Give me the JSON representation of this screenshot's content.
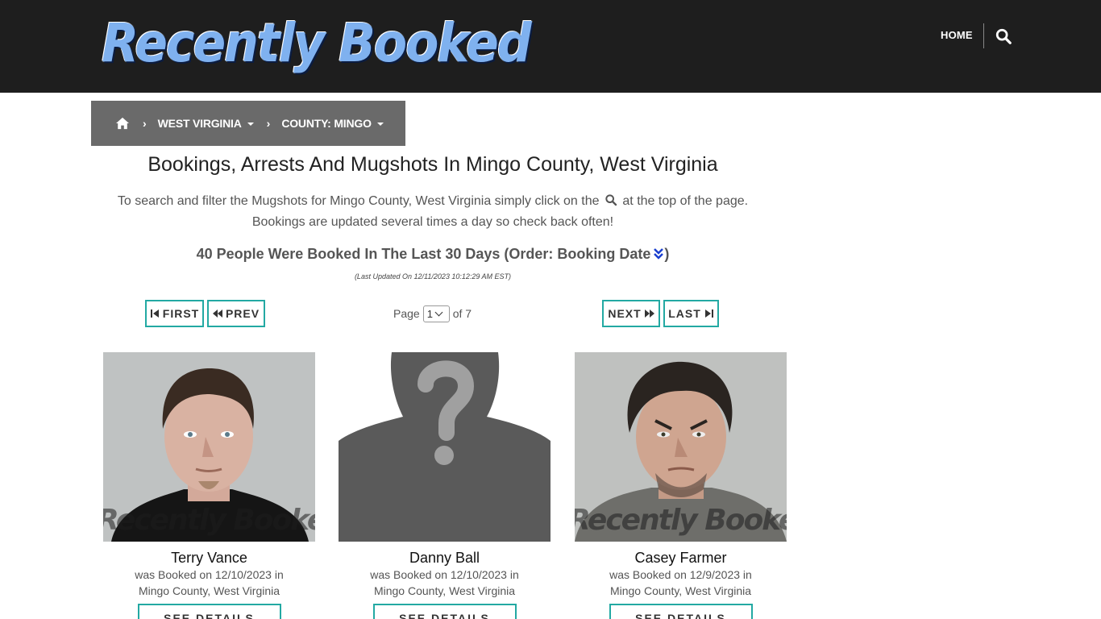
{
  "header": {
    "logo_text": "Recently Booked",
    "nav_home": "HOME",
    "search_icon": "search-icon"
  },
  "breadcrumb": {
    "home_icon": "home-icon",
    "state": "WEST VIRGINIA",
    "county": "COUNTY: MINGO"
  },
  "main": {
    "title": "Bookings, Arrests And Mugshots In Mingo County, West Virginia",
    "intro_before_icon": "To search and filter the Mugshots for Mingo County, West Virginia simply click on the",
    "intro_after_icon": "at the top of the page.",
    "intro_line2": "Bookings are updated several times a day so check back often!",
    "summary_prefix": "40 People Were Booked In The Last 30 Days (Order: Booking Date",
    "summary_suffix": ")",
    "last_updated": "(Last Updated On 12/11/2023 10:12:29 AM EST)"
  },
  "pager": {
    "first": "FIRST",
    "prev": "PREV",
    "next": "NEXT",
    "last": "LAST",
    "page_label": "Page",
    "current_page": "1",
    "of_label": "of 7"
  },
  "watermark": "Recently Booked.com",
  "bookings": [
    {
      "name": "Terry Vance",
      "booked_line": "was Booked on 12/10/2023 in",
      "location": "Mingo County, West Virginia",
      "details_label": "SEE DETAILS",
      "photo": "mugshot"
    },
    {
      "name": "Danny Ball",
      "booked_line": "was Booked on 12/10/2023 in",
      "location": "Mingo County, West Virginia",
      "details_label": "SEE DETAILS",
      "photo": "no-photo-silhouette"
    },
    {
      "name": "Casey Farmer",
      "booked_line": "was Booked on 12/9/2023 in",
      "location": "Mingo County, West Virginia",
      "details_label": "SEE DETAILS",
      "photo": "mugshot"
    }
  ]
}
